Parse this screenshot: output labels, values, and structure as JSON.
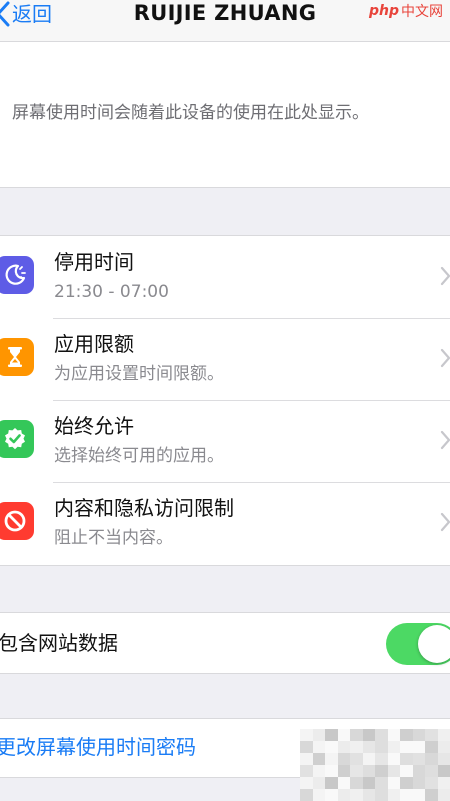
{
  "nav": {
    "back_label": "返回",
    "title": "RUIJIE ZHUANG"
  },
  "watermark": {
    "logo": "php",
    "text": "中文网"
  },
  "info": {
    "text": "屏幕使用时间会随着此设备的使用在此处显示。"
  },
  "settings": {
    "items": [
      {
        "title": "停用时间",
        "subtitle": "21:30 - 07:00",
        "icon": "downtime-icon",
        "color": "#5e5ce6"
      },
      {
        "title": "应用限额",
        "subtitle": "为应用设置时间限额。",
        "icon": "hourglass-icon",
        "color": "#ff9500"
      },
      {
        "title": "始终允许",
        "subtitle": "选择始终可用的应用。",
        "icon": "checkmark-seal-icon",
        "color": "#34c759"
      },
      {
        "title": "内容和隐私访问限制",
        "subtitle": "阻止不当内容。",
        "icon": "restriction-icon",
        "color": "#ff3b30"
      }
    ]
  },
  "website_data": {
    "label": "包含网站数据",
    "enabled": true
  },
  "passcode": {
    "label": "更改屏幕使用时间密码"
  },
  "colors": {
    "accent": "#1a7cf5",
    "toggle_on": "#4cd964",
    "background": "#efeff4"
  }
}
